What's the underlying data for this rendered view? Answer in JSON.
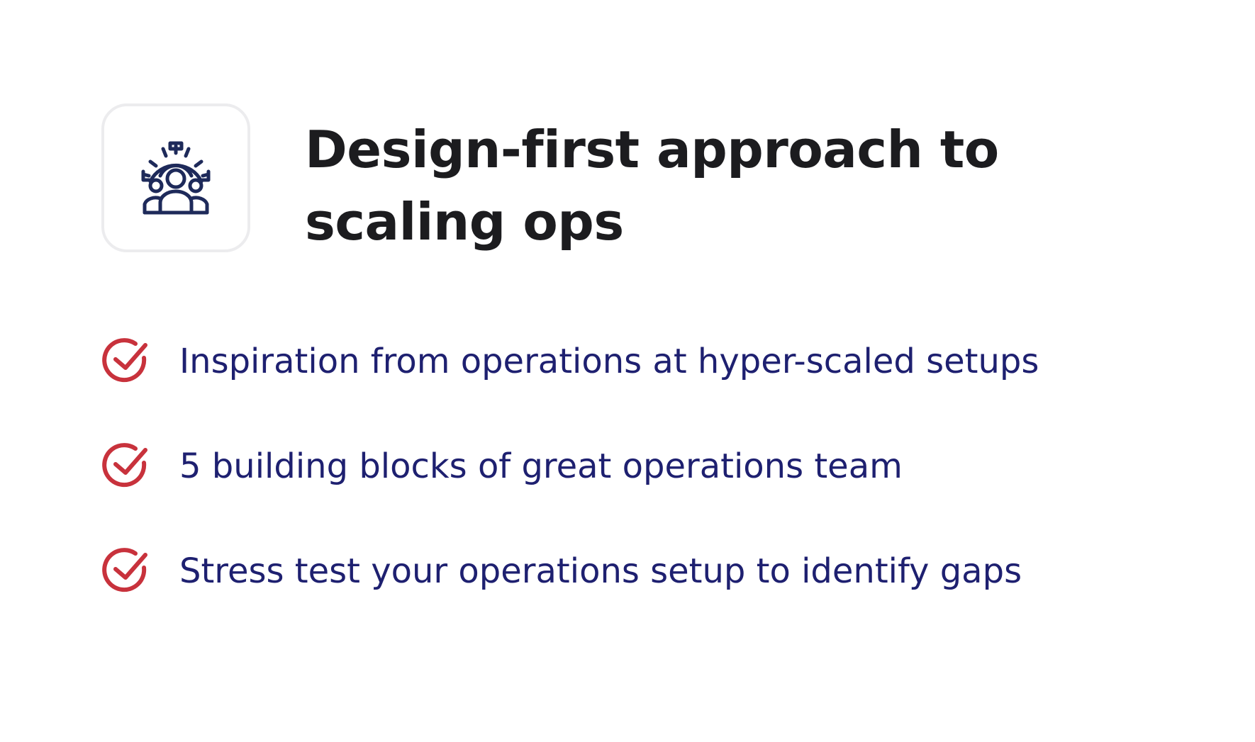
{
  "hero": {
    "icon": "team-gear-icon",
    "title": "Design-first approach to scaling ops"
  },
  "features": [
    {
      "icon": "check-circle-icon",
      "text": "Inspiration from operations at hyper-scaled setups"
    },
    {
      "icon": "check-circle-icon",
      "text": "5 building blocks of great operations team"
    },
    {
      "icon": "check-circle-icon",
      "text": "Stress test your operations setup to identify gaps"
    }
  ],
  "colors": {
    "title": "#1c1c1f",
    "feature_text": "#1e2070",
    "check": "#c8323c",
    "icon": "#1e2a5a",
    "tile_border": "#ececee"
  }
}
